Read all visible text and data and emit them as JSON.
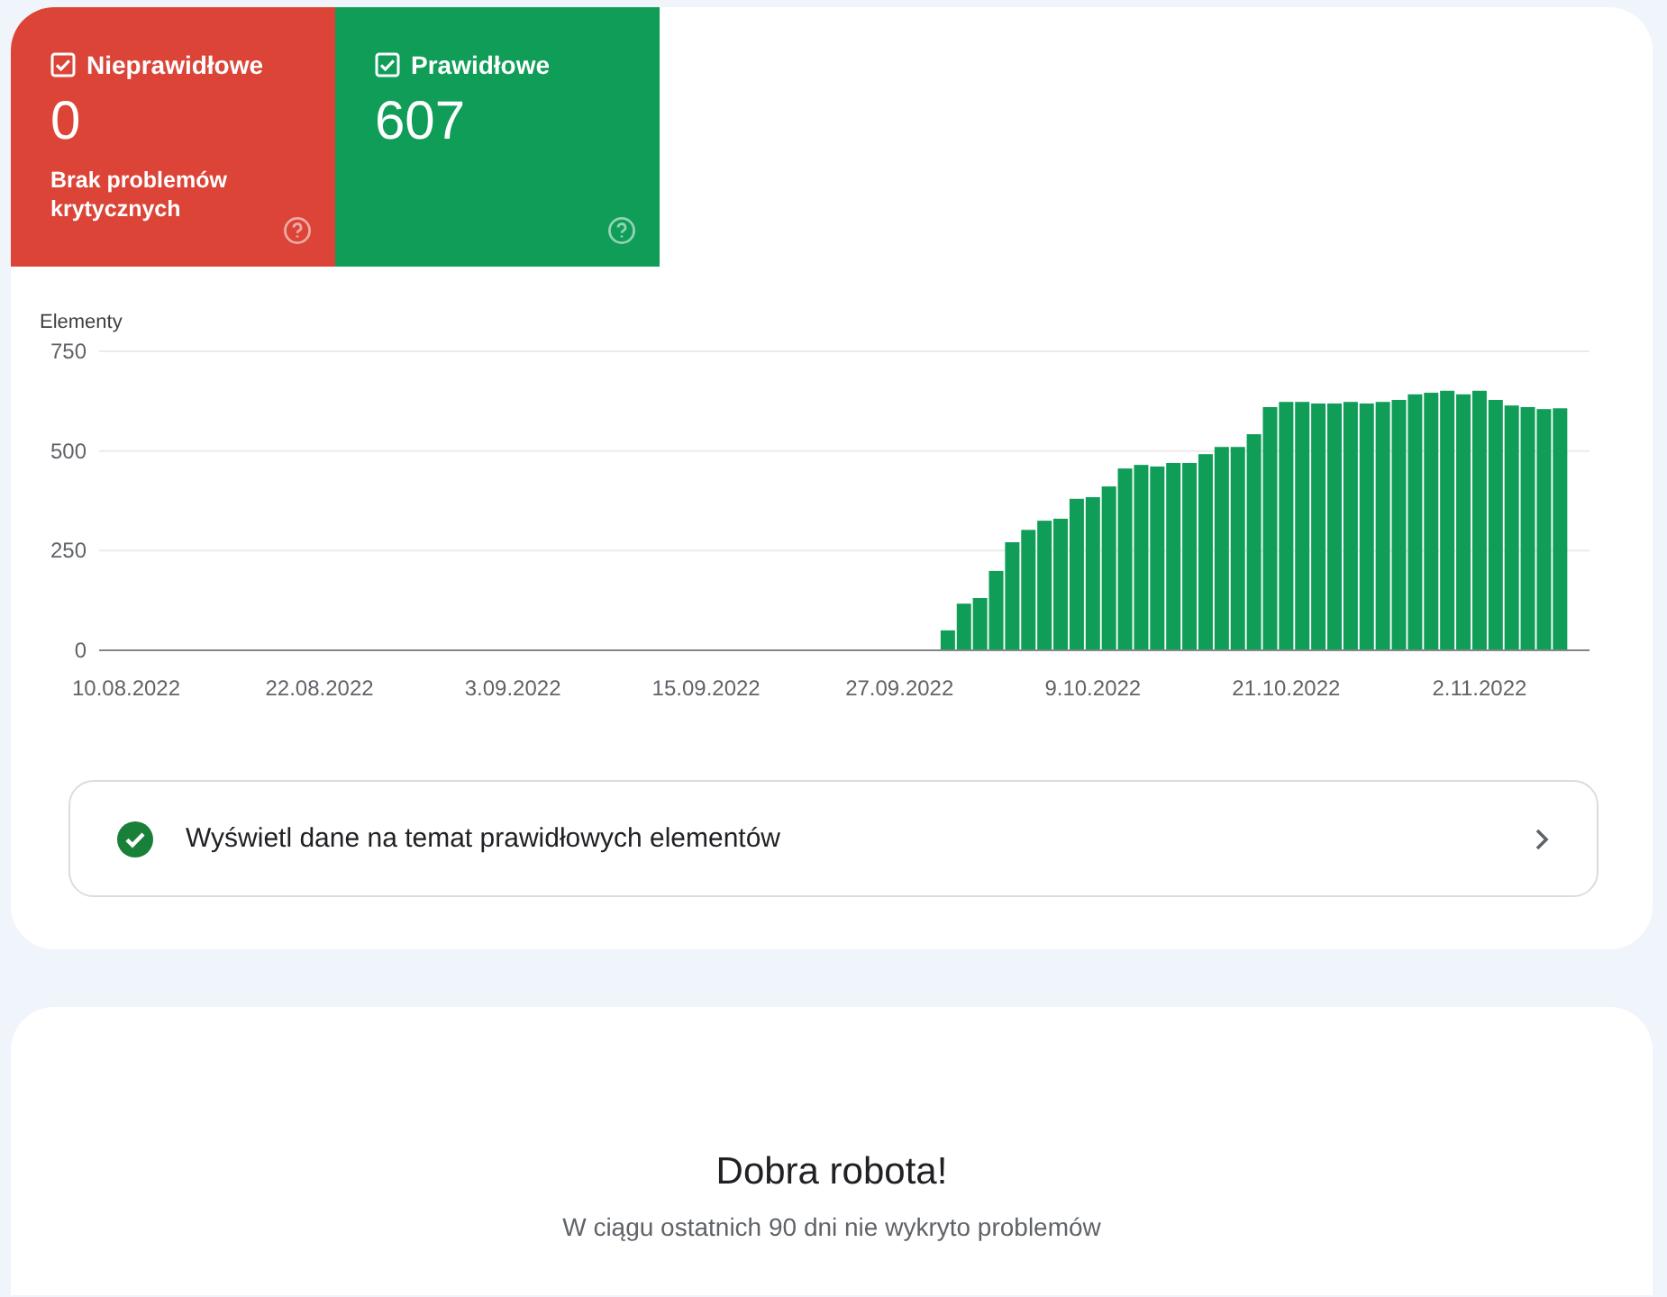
{
  "tiles": [
    {
      "label": "Nieprawidłowe",
      "checked": true,
      "count": "0",
      "note": "Brak problemów krytycznych",
      "color": "#db4437"
    },
    {
      "label": "Prawidłowe",
      "checked": true,
      "count": "607",
      "color": "#0f9d58"
    }
  ],
  "chart": {
    "chart_data": {
      "type": "bar",
      "ylabel": "Elementy",
      "categories": [
        "10.08.2022",
        null,
        null,
        null,
        null,
        null,
        null,
        null,
        null,
        null,
        null,
        null,
        "22.08.2022",
        null,
        null,
        null,
        null,
        null,
        null,
        null,
        null,
        null,
        null,
        null,
        "3.09.2022",
        null,
        null,
        null,
        null,
        null,
        null,
        null,
        null,
        null,
        null,
        null,
        "15.09.2022",
        null,
        null,
        null,
        null,
        null,
        null,
        null,
        null,
        null,
        null,
        null,
        "27.09.2022",
        null,
        null,
        null,
        null,
        null,
        null,
        null,
        null,
        null,
        null,
        null,
        "9.10.2022",
        null,
        null,
        null,
        null,
        null,
        null,
        null,
        null,
        null,
        null,
        null,
        "21.10.2022",
        null,
        null,
        null,
        null,
        null,
        null,
        null,
        null,
        null,
        null,
        null,
        "2.11.2022",
        null,
        null,
        null,
        null,
        null
      ],
      "series": [
        {
          "color": "#0f9d58",
          "values": [
            0,
            0,
            0,
            0,
            0,
            0,
            0,
            0,
            0,
            0,
            0,
            0,
            0,
            0,
            0,
            0,
            0,
            0,
            0,
            0,
            0,
            0,
            0,
            0,
            0,
            0,
            0,
            0,
            0,
            0,
            0,
            0,
            0,
            0,
            0,
            0,
            0,
            0,
            0,
            0,
            0,
            0,
            0,
            0,
            0,
            0,
            0,
            0,
            0,
            0,
            0,
            50,
            117,
            131,
            199,
            271,
            302,
            325,
            330,
            380,
            384,
            411,
            456,
            465,
            461,
            470,
            470,
            492,
            510,
            510,
            542,
            610,
            623,
            623,
            619,
            619,
            623,
            619,
            623,
            628,
            642,
            646,
            651,
            642,
            651,
            628,
            614,
            610,
            605,
            607
          ]
        }
      ],
      "ylim": [
        0,
        750
      ],
      "yticks": [
        0,
        250,
        500,
        750
      ]
    }
  },
  "link": {
    "label": "Wyświetl dane na temat prawidłowych elementów"
  },
  "summary": {
    "title": "Dobra robota!",
    "text": "W ciągu ostatnich 90 dni nie wykryto problemów"
  }
}
